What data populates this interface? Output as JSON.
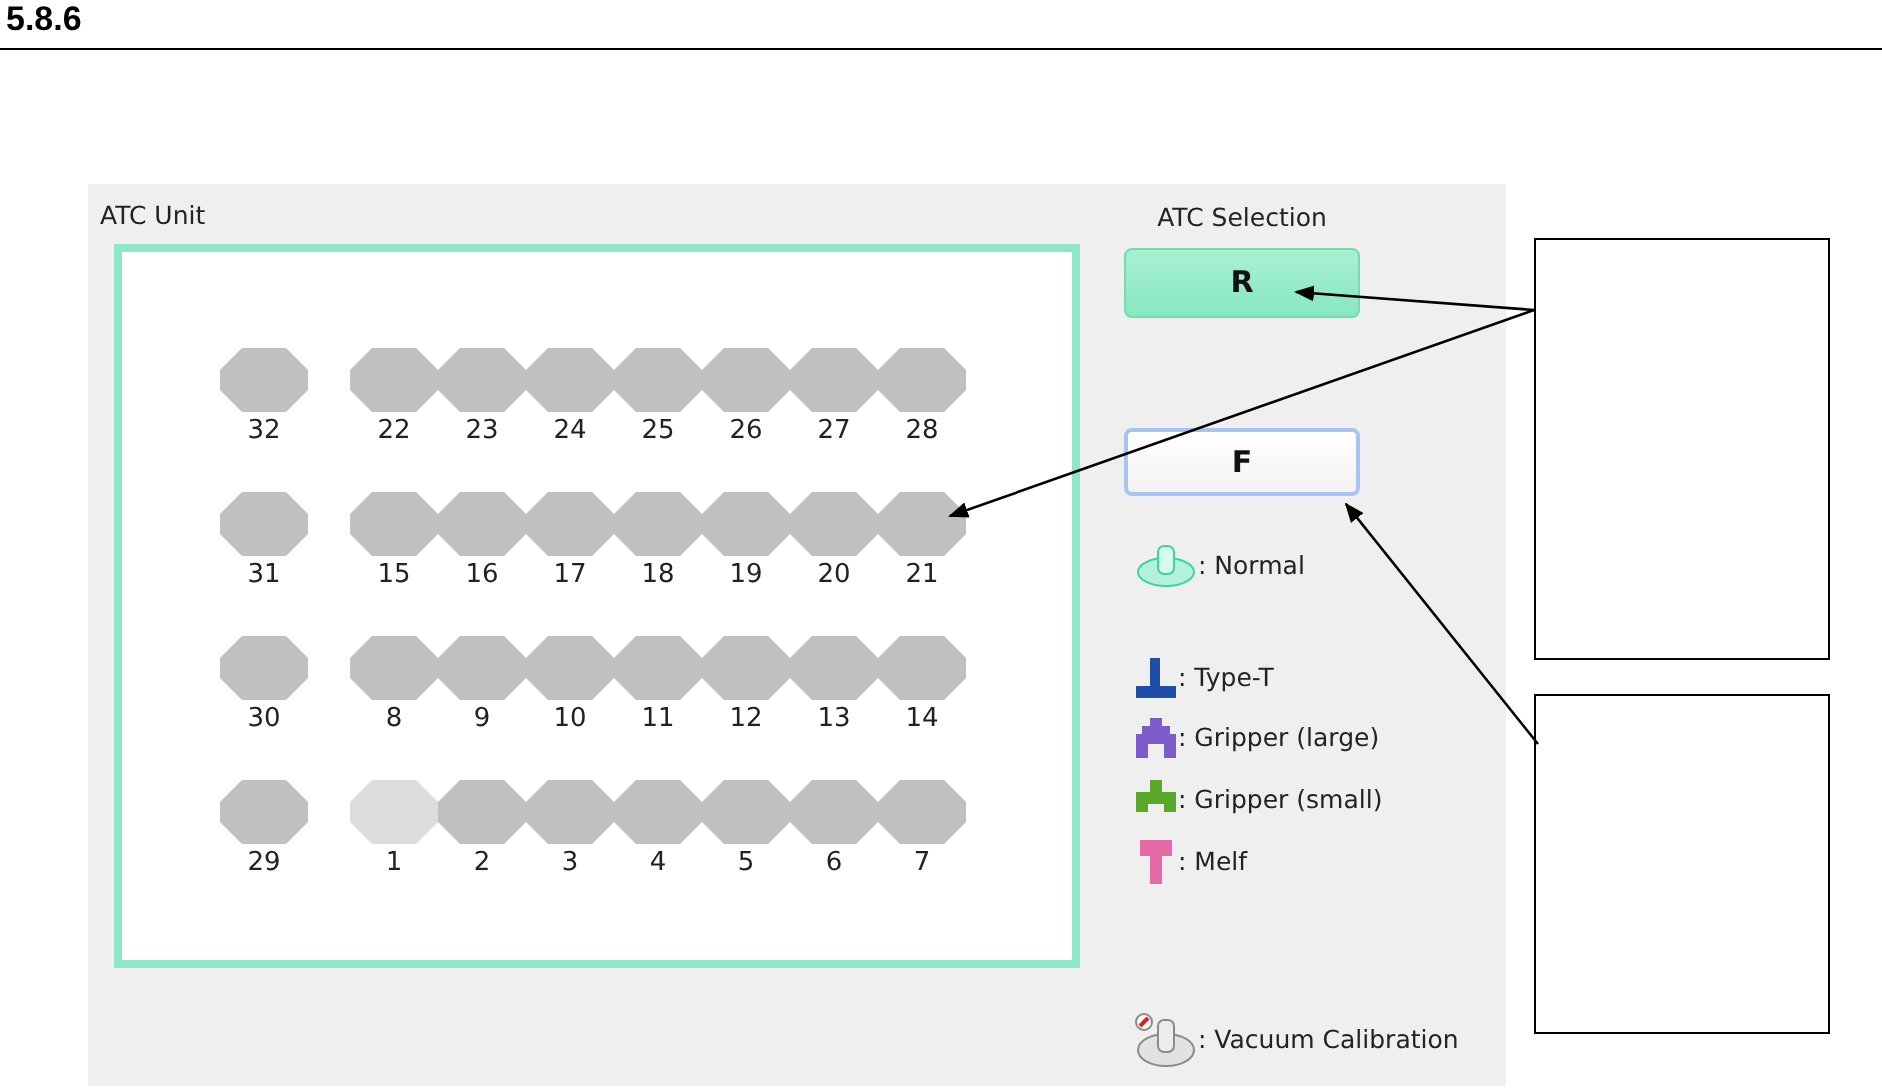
{
  "heading": "5.8.6",
  "atc_unit": {
    "title": "ATC Unit",
    "rows": [
      [
        {
          "label": "32",
          "kind": "filled"
        },
        {
          "label": "22",
          "kind": "filled"
        },
        {
          "label": "23",
          "kind": "filled"
        },
        {
          "label": "24",
          "kind": "filled"
        },
        {
          "label": "25",
          "kind": "filled"
        },
        {
          "label": "26",
          "kind": "filled"
        },
        {
          "label": "27",
          "kind": "filled"
        },
        {
          "label": "28",
          "kind": "filled"
        }
      ],
      [
        {
          "label": "31",
          "kind": "filled"
        },
        {
          "label": "15",
          "kind": "filled"
        },
        {
          "label": "16",
          "kind": "filled"
        },
        {
          "label": "17",
          "kind": "filled"
        },
        {
          "label": "18",
          "kind": "filled"
        },
        {
          "label": "19",
          "kind": "filled"
        },
        {
          "label": "20",
          "kind": "filled"
        },
        {
          "label": "21",
          "kind": "filled"
        }
      ],
      [
        {
          "label": "30",
          "kind": "filled"
        },
        {
          "label": "8",
          "kind": "filled"
        },
        {
          "label": "9",
          "kind": "filled"
        },
        {
          "label": "10",
          "kind": "filled"
        },
        {
          "label": "11",
          "kind": "filled"
        },
        {
          "label": "12",
          "kind": "filled"
        },
        {
          "label": "13",
          "kind": "filled"
        },
        {
          "label": "14",
          "kind": "filled"
        }
      ],
      [
        {
          "label": "29",
          "kind": "filled"
        },
        {
          "label": "1",
          "kind": "empty"
        },
        {
          "label": "2",
          "kind": "filled"
        },
        {
          "label": "3",
          "kind": "filled"
        },
        {
          "label": "4",
          "kind": "filled"
        },
        {
          "label": "5",
          "kind": "filled"
        },
        {
          "label": "6",
          "kind": "filled"
        },
        {
          "label": "7",
          "kind": "filled"
        }
      ]
    ]
  },
  "atc_selection": {
    "title": "ATC Selection",
    "buttons": [
      {
        "label": "R",
        "selected": true
      },
      {
        "label": "F",
        "selected": false
      }
    ]
  },
  "legend": [
    {
      "kind": "normal",
      "label": ": Normal"
    },
    {
      "kind": "type-t",
      "label": ": Type-T"
    },
    {
      "kind": "gripper-large",
      "label": ": Gripper (large)"
    },
    {
      "kind": "gripper-small",
      "label": ": Gripper (small)"
    },
    {
      "kind": "melf",
      "label": ": Melf"
    },
    {
      "kind": "vacuum",
      "label": ": Vacuum Calibration"
    }
  ]
}
